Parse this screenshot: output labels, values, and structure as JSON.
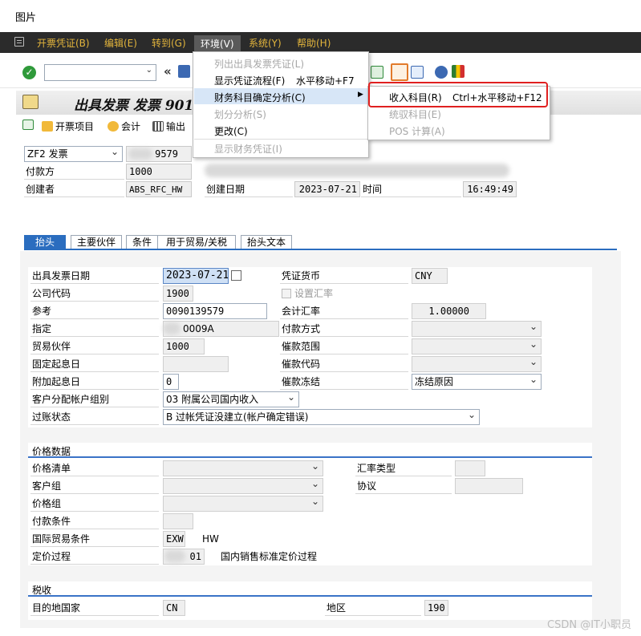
{
  "window_title": "图片",
  "menubar": {
    "items": [
      "开票凭证(B)",
      "编辑(E)",
      "转到(G)",
      "环境(V)",
      "系统(Y)",
      "帮助(H)"
    ]
  },
  "title": "出具发票 发票 901",
  "app_toolbar": {
    "items": [
      "开票项目",
      "会计",
      "输出"
    ]
  },
  "header": {
    "doc_type": "ZF2 发票",
    "doc_number": "9579",
    "payer_label": "付款方",
    "payer_value": "1000",
    "created_by_label": "创建者",
    "created_by_value": "ABS_RFC_HW",
    "created_on_label": "创建日期",
    "created_on_value": "2023-07-21",
    "time_label": "时间",
    "time_value": "16:49:49"
  },
  "tabs": [
    "抬头",
    "主要伙伴",
    "条件",
    "用于贸易/关税",
    "抬头文本"
  ],
  "form": {
    "billing_date_label": "出具发票日期",
    "billing_date_value": "2023-07-21",
    "currency_label": "凭证货币",
    "currency_value": "CNY",
    "company_code_label": "公司代码",
    "company_code_value": "1900",
    "set_exchange_rate_label": "设置汇率",
    "reference_label": "参考",
    "reference_value": "0090139579",
    "exchange_rate_label": "会计汇率",
    "exchange_rate_value": "1.00000",
    "assignment_label": "指定",
    "assignment_value": "0009A",
    "payment_method_label": "付款方式",
    "trading_partner_label": "贸易伙伴",
    "trading_partner_value": "1000",
    "dunning_area_label": "催款范围",
    "fixed_value_date_label": "固定起息日",
    "dunning_key_label": "催款代码",
    "add_value_days_label": "附加起息日",
    "add_value_days_value": "0",
    "dunning_block_label": "催款冻结",
    "dunning_block_value": "冻结原因",
    "acct_assign_group_label": "客户分配帐户组别",
    "acct_assign_group_value": "03 附属公司国内收入",
    "posting_status_label": "过账状态",
    "posting_status_value": "B 过帐凭证没建立(帐户确定错误)"
  },
  "pricing": {
    "section_title": "价格数据",
    "price_list_label": "价格清单",
    "exchange_rate_type_label": "汇率类型",
    "customer_group_label": "客户组",
    "agreement_label": "协议",
    "price_group_label": "价格组",
    "payment_terms_label": "付款条件",
    "incoterms_label": "国际贸易条件",
    "incoterms_value": "EXW",
    "incoterms_place": "HW",
    "pricing_procedure_label": "定价过程",
    "pricing_procedure_value": "01",
    "pricing_procedure_desc": "国内销售标准定价过程"
  },
  "tax": {
    "section_title": "税收",
    "destination_country_label": "目的地国家",
    "destination_country_value": "CN",
    "region_label": "地区",
    "region_value": "190"
  },
  "env_menu": {
    "items": [
      {
        "label": "列出出具发票凭证(L)",
        "disabled": true
      },
      {
        "label": "显示凭证流程(F)",
        "shortcut": "水平移动+F7",
        "disabled": false
      },
      {
        "label": "财务科目确定分析(C)",
        "disabled": false,
        "has_submenu": true
      },
      {
        "label": "划分分析(S)",
        "disabled": true
      },
      {
        "label": "更改(C)",
        "disabled": false
      },
      {
        "label": "显示财务凭证(I)",
        "disabled": true
      }
    ]
  },
  "sub_menu": {
    "items": [
      {
        "label": "收入科目(R)",
        "shortcut": "Ctrl+水平移动+F12",
        "disabled": false
      },
      {
        "label": "统驭科目(E)",
        "disabled": true
      },
      {
        "label": "POS 计算(A)",
        "disabled": true
      }
    ]
  },
  "watermark": "CSDN @IT小职员",
  "colors": {
    "menubar_bg": "#2b2b2b",
    "menubar_text": "#e3b53c",
    "tab_active": "#2b6dbf",
    "highlight_box": "#e02020"
  }
}
